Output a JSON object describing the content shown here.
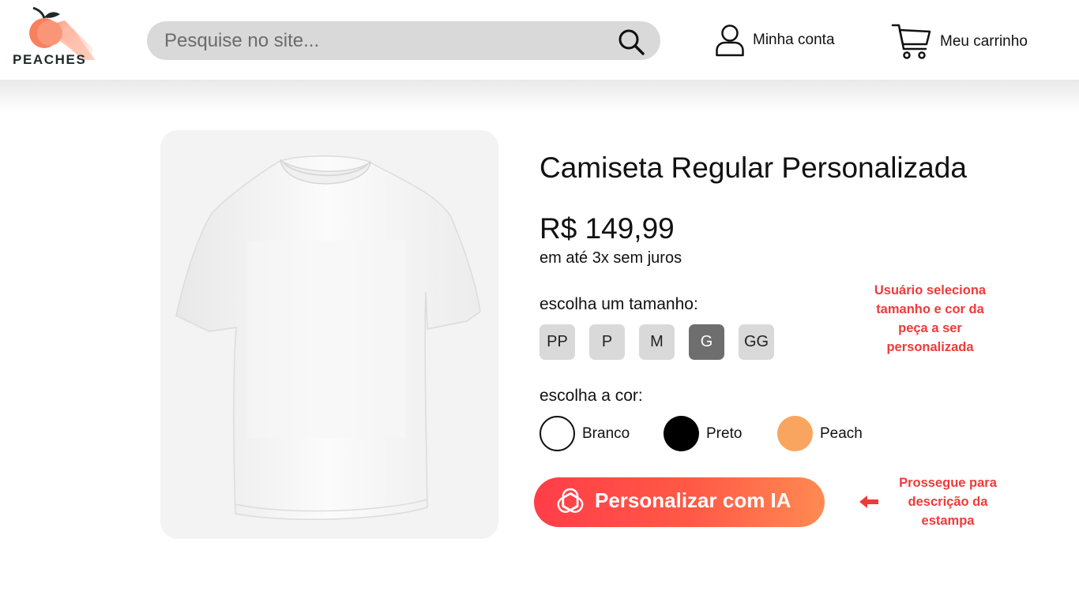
{
  "header": {
    "logo_text": "PEACHES",
    "search": {
      "placeholder": "Pesquise no site..."
    },
    "account_label": "Minha conta",
    "cart_label": "Meu carrinho"
  },
  "product": {
    "title": "Camiseta Regular Personalizada",
    "price": "R$ 149,99",
    "installments": "em até 3x sem juros",
    "size_label": "escolha um tamanho:",
    "sizes": [
      "PP",
      "P",
      "M",
      "G",
      "GG"
    ],
    "selected_size": "G",
    "color_label": "escolha a cor:",
    "colors": [
      {
        "name": "Branco",
        "hex": "#ffffff"
      },
      {
        "name": "Preto",
        "hex": "#000000"
      },
      {
        "name": "Peach",
        "hex": "#f9a560"
      }
    ],
    "cta_label": "Personalizar com IA"
  },
  "annotations": {
    "selection_note": "Usuário seleciona tamanho e cor da peça a ser personalizada",
    "cta_note": "Prossegue para descrição da estampa"
  },
  "theme": {
    "accent": "#ff4a47",
    "annotation_color": "#f03a3a",
    "search_bg": "#d9d9d9",
    "size_selected_bg": "#6e6e6e"
  },
  "icons": [
    "peach-logo-icon",
    "search-icon",
    "user-icon",
    "cart-icon",
    "openai-icon",
    "arrow-left-icon"
  ]
}
